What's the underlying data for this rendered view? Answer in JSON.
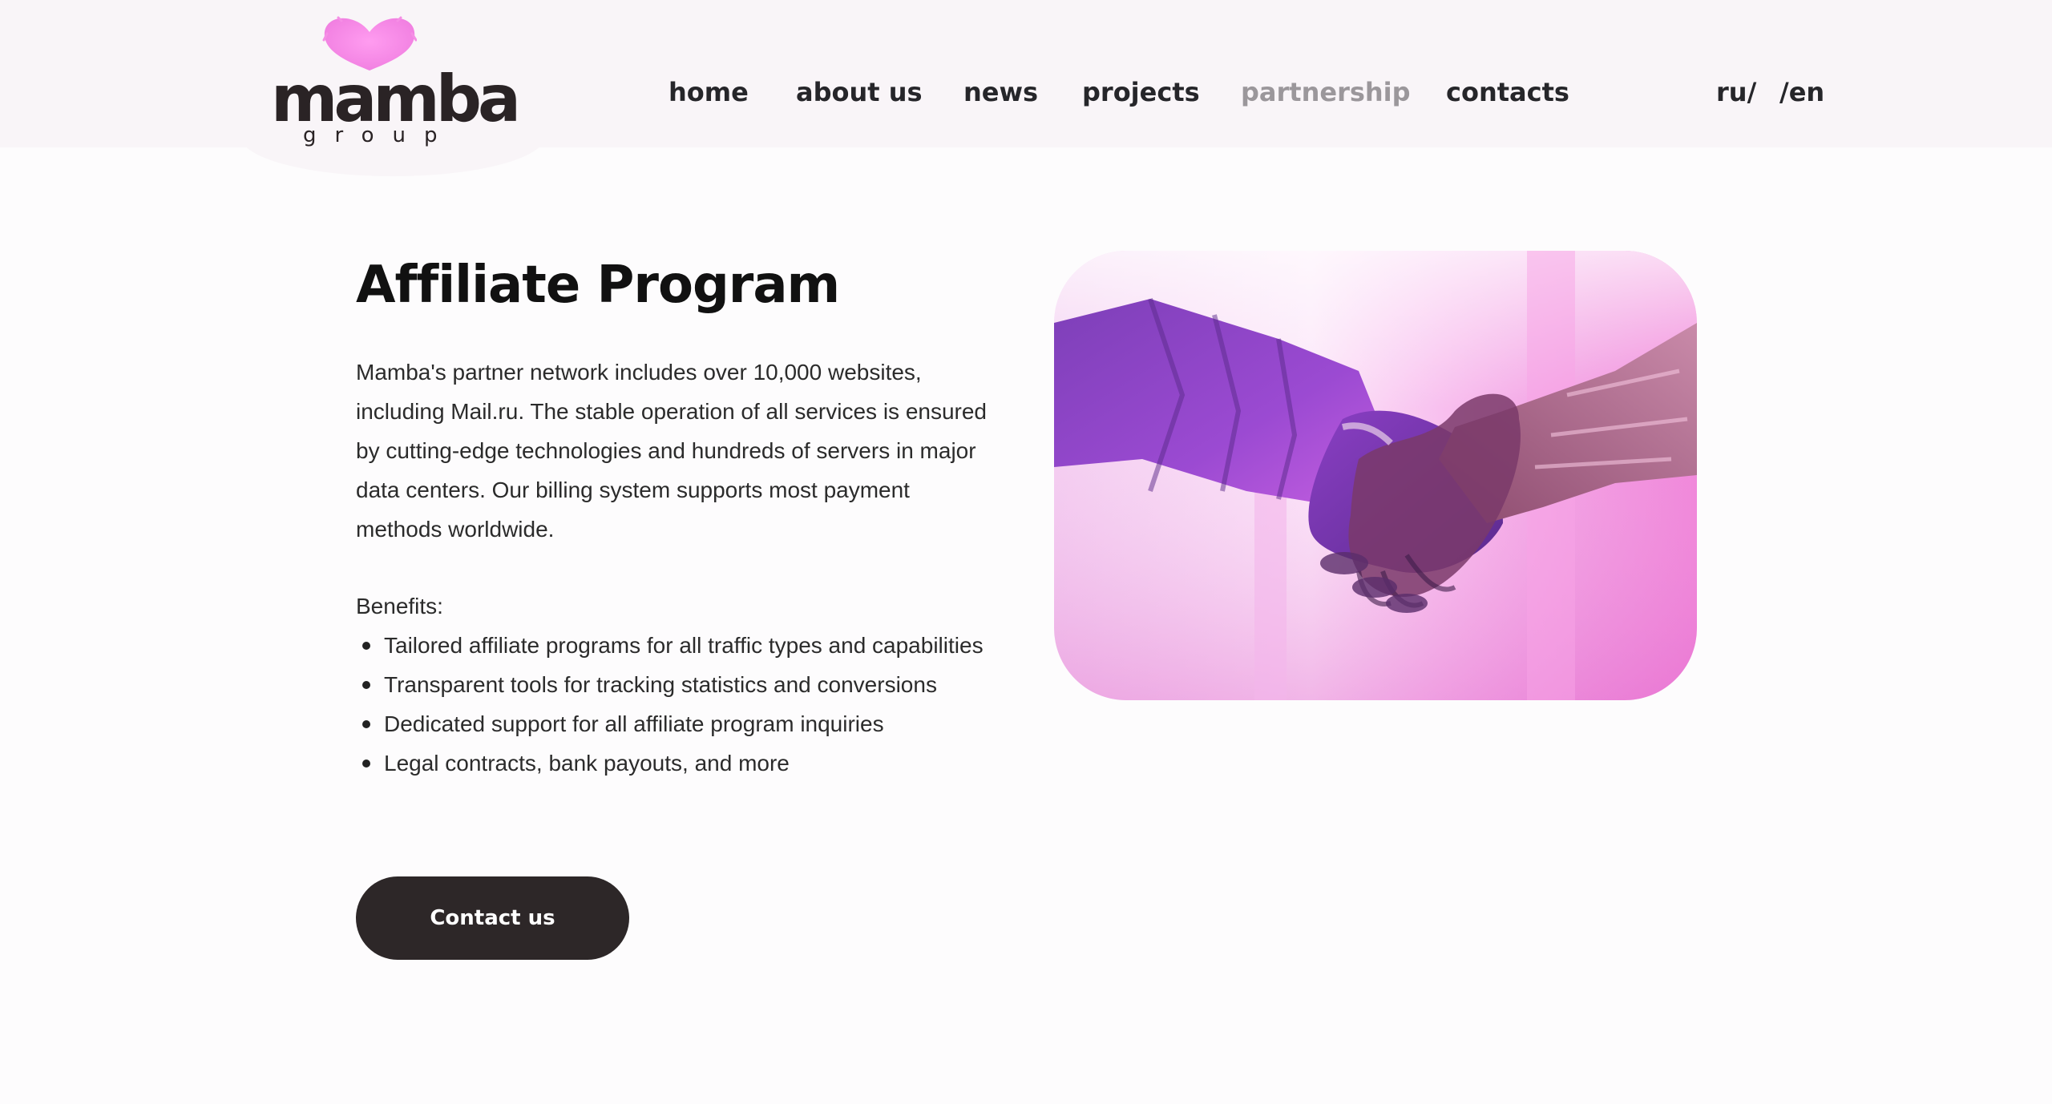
{
  "logo": {
    "wordmark": "mamba",
    "subtitle": "group",
    "heart_color": "#f48fe6"
  },
  "nav": {
    "items": [
      {
        "label": "home",
        "active": false
      },
      {
        "label": "about us",
        "active": false
      },
      {
        "label": "news",
        "active": false
      },
      {
        "label": "projects",
        "active": false
      },
      {
        "label": "partnership",
        "active": true
      },
      {
        "label": "contacts",
        "active": false
      }
    ],
    "lang_ru": "ru/",
    "lang_en": "/en"
  },
  "main": {
    "title": "Affiliate Program",
    "intro": "Mamba's partner network includes over 10,000 websites, including Mail.ru. The stable operation of all services is ensured by cutting-edge technologies and hundreds of servers in major data centers. Our billing system supports most payment methods worldwide.",
    "benefits_title": "Benefits:",
    "benefits": [
      "Tailored affiliate programs for all traffic types and capabilities",
      "Transparent tools for tracking statistics and conversions",
      "Dedicated support for all affiliate program inquiries",
      "Legal contracts, bank payouts, and more"
    ],
    "contact_label": "Contact us"
  },
  "colors": {
    "accent_pink": "#f48fe6",
    "button_bg": "#2d2728",
    "nav_active": "#9b979b"
  },
  "icons": {
    "logo": "heart-icon",
    "bullet": "bullet-dot-icon"
  }
}
